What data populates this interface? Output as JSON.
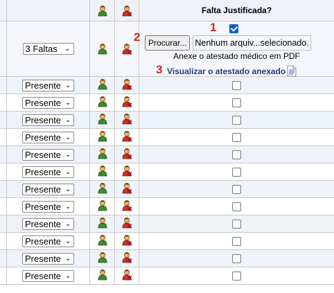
{
  "header": {
    "title": "Falta Justificada?"
  },
  "first_row": {
    "select_value": "3 Faltas",
    "browse_label": "Procurar...",
    "file_status": "Nenhum arquiv...selecionado.",
    "hint": "Anexe o atestado médico em PDF",
    "view_link": "Visualizar o atestado anexado",
    "justified_checked": true,
    "markers": [
      "1",
      "2",
      "3"
    ]
  },
  "rows": [
    {
      "status": "Presente",
      "justified": false
    },
    {
      "status": "Presente",
      "justified": false
    },
    {
      "status": "Presente",
      "justified": false
    },
    {
      "status": "Presente",
      "justified": false
    },
    {
      "status": "Presente",
      "justified": false
    },
    {
      "status": "Presente",
      "justified": false
    },
    {
      "status": "Presente",
      "justified": false
    },
    {
      "status": "Presente",
      "justified": false
    },
    {
      "status": "Presente",
      "justified": false
    },
    {
      "status": "Presente",
      "justified": false
    },
    {
      "status": "Presente",
      "justified": false
    },
    {
      "status": "Presente",
      "justified": false
    }
  ],
  "icons": {
    "present": "user-present-icon",
    "absent": "user-absent-icon",
    "document": "document-icon"
  },
  "colors": {
    "marker_red": "#d0262d",
    "link_blue": "#1f3f7a",
    "checkbox_blue": "#0b61c9",
    "row_alt": "#eef2fa"
  }
}
